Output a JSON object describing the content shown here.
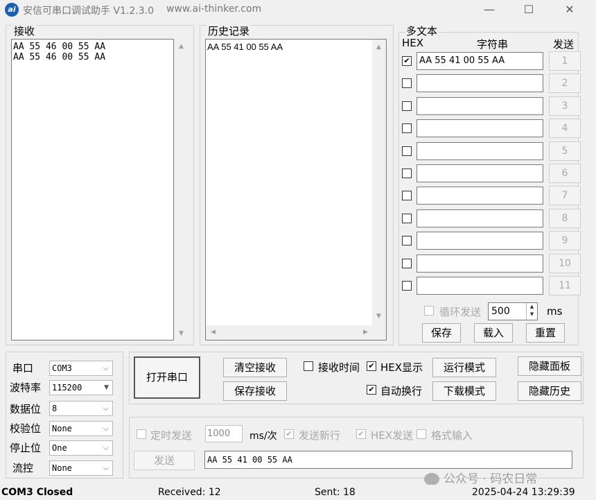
{
  "window": {
    "title": "安信可串口调试助手 V1.2.3.0",
    "url": "www.ai-thinker.com",
    "icon_text": "ai",
    "minimize_icon": "—",
    "maximize_icon": "☐",
    "close_icon": "✕"
  },
  "receive": {
    "label": "接收",
    "lines": [
      "AA 55 46 00 55 AA",
      "AA 55 46 00 55 AA"
    ]
  },
  "history": {
    "label": "历史记录",
    "lines": [
      "AA 55 41 00 55 AA"
    ]
  },
  "multitext": {
    "label": "多文本",
    "col_hex": "HEX",
    "col_string": "字符串",
    "col_send": "发送",
    "rows": [
      {
        "checked": true,
        "value": "AA 55 41 00 55 AA",
        "send": "1"
      },
      {
        "checked": false,
        "value": "",
        "send": "2"
      },
      {
        "checked": false,
        "value": "",
        "send": "3"
      },
      {
        "checked": false,
        "value": "",
        "send": "4"
      },
      {
        "checked": false,
        "value": "",
        "send": "5"
      },
      {
        "checked": false,
        "value": "",
        "send": "6"
      },
      {
        "checked": false,
        "value": "",
        "send": "7"
      },
      {
        "checked": false,
        "value": "",
        "send": "8"
      },
      {
        "checked": false,
        "value": "",
        "send": "9"
      },
      {
        "checked": false,
        "value": "",
        "send": "10"
      },
      {
        "checked": false,
        "value": "",
        "send": "11"
      }
    ],
    "loop_send_label": "循环发送",
    "loop_interval": "500",
    "loop_unit": "ms",
    "save_label": "保存",
    "load_label": "载入",
    "reset_label": "重置"
  },
  "serial": {
    "port_label": "串口",
    "port_value": "COM3",
    "baud_label": "波特率",
    "baud_value": "115200",
    "databits_label": "数据位",
    "databits_value": "8",
    "parity_label": "校验位",
    "parity_value": "None",
    "stopbits_label": "停止位",
    "stopbits_value": "One",
    "flow_label": "流控",
    "flow_value": "None"
  },
  "controls": {
    "open_port": "打开串口",
    "clear_receive": "清空接收",
    "save_receive": "保存接收",
    "receive_time": "接收时间",
    "hex_display": "HEX显示",
    "auto_newline": "自动换行",
    "run_mode": "运行模式",
    "download_mode": "下载模式",
    "hide_panel": "隐藏面板",
    "hide_history": "隐藏历史"
  },
  "send_area": {
    "timed_send": "定时发送",
    "interval": "1000",
    "interval_unit": "ms/次",
    "send_newline": "发送新行",
    "hex_send": "HEX发送",
    "format_input": "格式输入",
    "send_button": "发送",
    "send_value": "AA 55 41 00 55 AA"
  },
  "status": {
    "port_state": "COM3 Closed",
    "received": "Received: 12",
    "sent": "Sent: 18",
    "timestamp": "2025-04-24 13:29:39"
  },
  "watermark": {
    "text": "公众号 · 码农日常"
  }
}
